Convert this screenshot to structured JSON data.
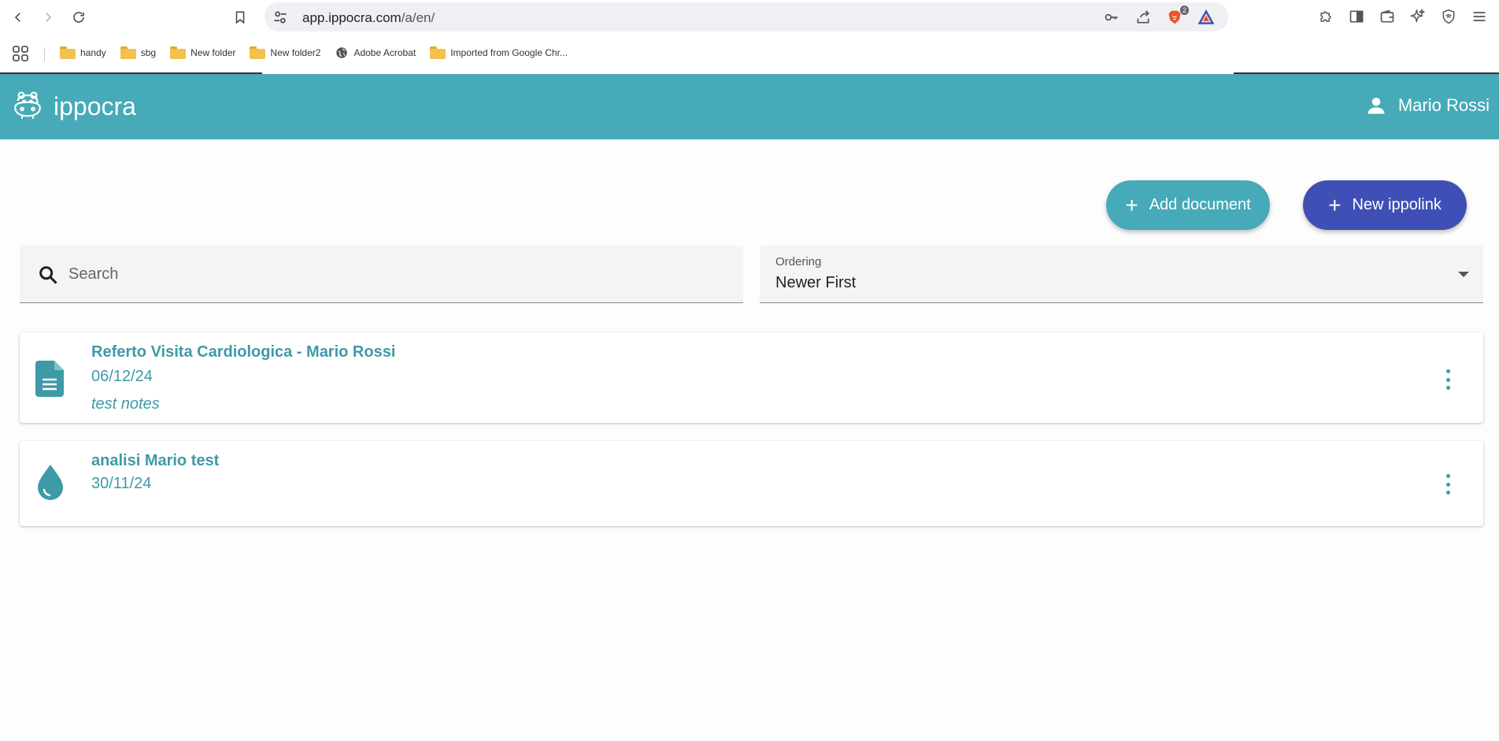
{
  "browser": {
    "url_host": "app.ippocra.com",
    "url_path": "/a/en/",
    "brave_badge": "2",
    "bookmarks": [
      {
        "label": "handy",
        "icon": "folder-icon"
      },
      {
        "label": "sbg",
        "icon": "folder-icon"
      },
      {
        "label": "New folder",
        "icon": "folder-icon"
      },
      {
        "label": "New folder2",
        "icon": "folder-icon"
      },
      {
        "label": "Adobe Acrobat",
        "icon": "globe-icon"
      },
      {
        "label": "Imported from Google Chr...",
        "icon": "folder-icon"
      }
    ]
  },
  "app": {
    "name": "ippocra",
    "user_name": "Mario Rossi",
    "brand_color": "#46aab8",
    "secondary_color": "#3f4fb5"
  },
  "actions": {
    "add_document": "Add document",
    "new_ippolink": "New ippolink"
  },
  "search": {
    "placeholder": "Search"
  },
  "ordering": {
    "label": "Ordering",
    "value": "Newer First"
  },
  "documents": [
    {
      "icon": "document-icon",
      "title": "Referto Visita Cardiologica - Mario Rossi",
      "date": "06/12/24",
      "notes": "test notes"
    },
    {
      "icon": "drop-icon",
      "title": "analisi Mario test",
      "date": "30/11/24",
      "notes": ""
    }
  ]
}
